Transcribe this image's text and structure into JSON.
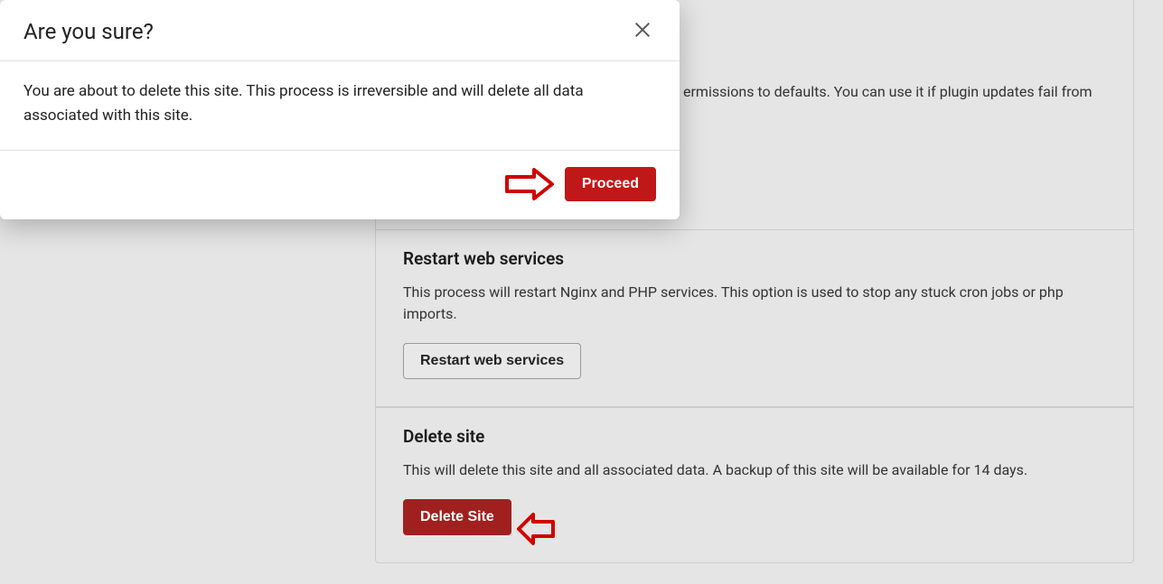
{
  "modal": {
    "title": "Are you sure?",
    "body": "You are about to delete this site. This process is irreversible and will delete all data associated with this site.",
    "proceed_label": "Proceed"
  },
  "sections": {
    "permissions": {
      "desc_fragment": "ermissions to defaults. You can use it if plugin updates fail from"
    },
    "restart": {
      "title": "Restart web services",
      "desc": "This process will restart Nginx and PHP services. This option is used to stop any stuck cron jobs or php imports.",
      "button": "Restart web services"
    },
    "delete": {
      "title": "Delete site",
      "desc": "This will delete this site and all associated data. A backup of this site will be available for 14 days.",
      "button": "Delete Site"
    }
  }
}
